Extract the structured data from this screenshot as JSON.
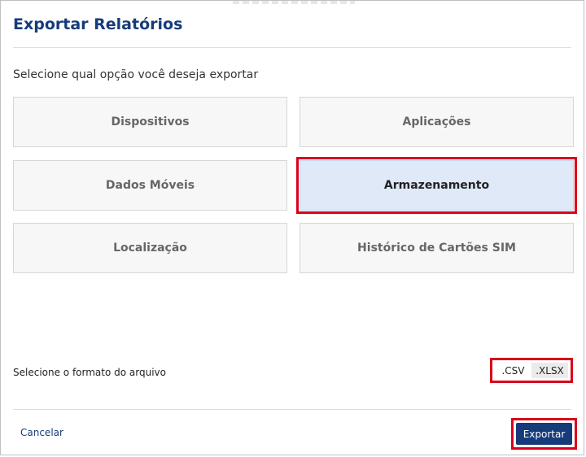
{
  "dialog": {
    "title": "Exportar Relatórios",
    "prompt": "Selecione qual opção você deseja exportar"
  },
  "options": [
    {
      "label": "Dispositivos",
      "selected": false
    },
    {
      "label": "Aplicações",
      "selected": false
    },
    {
      "label": "Dados Móveis",
      "selected": false
    },
    {
      "label": "Armazenamento",
      "selected": true
    },
    {
      "label": "Localização",
      "selected": false
    },
    {
      "label": "Histórico de Cartões SIM",
      "selected": false
    }
  ],
  "format": {
    "label": "Selecione o formato do arquivo",
    "options": [
      ".CSV",
      ".XLSX"
    ],
    "selected": ".XLSX"
  },
  "footer": {
    "cancel_label": "Cancelar",
    "export_label": "Exportar"
  },
  "colors": {
    "accent": "#163b7a",
    "highlight": "#d9001b",
    "selected_bg": "#dfe9f7"
  }
}
